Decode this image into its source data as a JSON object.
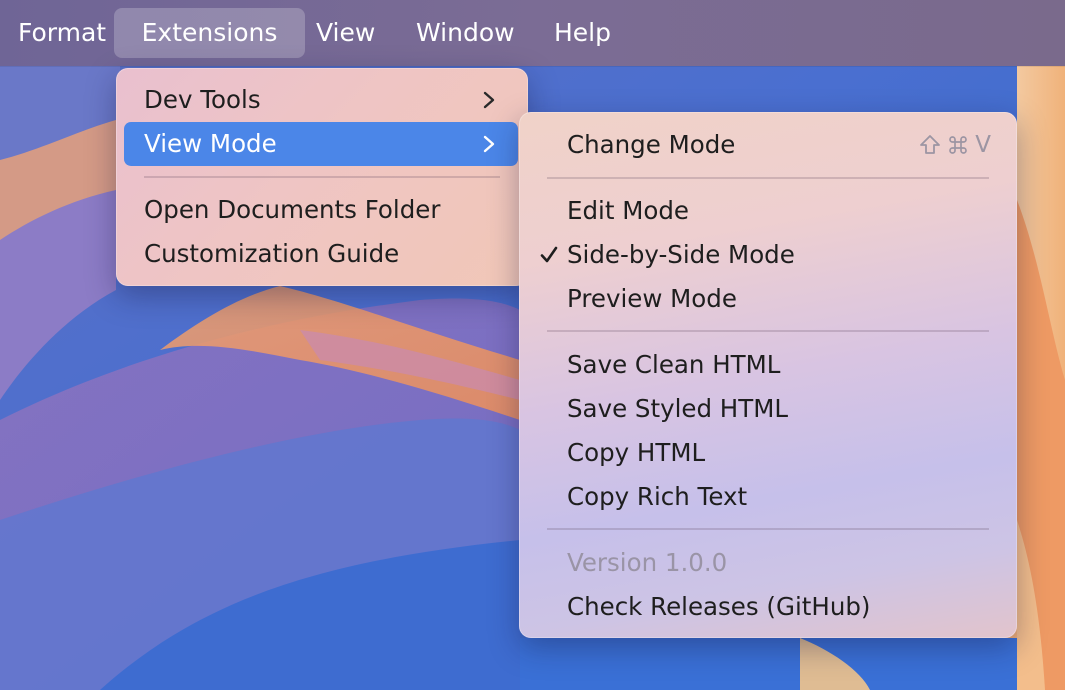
{
  "menubar": {
    "items": [
      {
        "label": "Format"
      },
      {
        "label": "Extensions"
      },
      {
        "label": "View"
      },
      {
        "label": "Window"
      },
      {
        "label": "Help"
      }
    ],
    "active_item": "Extensions"
  },
  "extensions_menu": {
    "items": [
      {
        "label": "Dev Tools",
        "submenu": true
      },
      {
        "label": "View Mode",
        "submenu": true,
        "highlighted": true
      },
      {
        "label": "Open Documents Folder"
      },
      {
        "label": "Customization Guide"
      }
    ]
  },
  "view_mode_submenu": {
    "change_mode": {
      "label": "Change Mode",
      "shortcut": "V"
    },
    "modes": [
      {
        "label": "Edit Mode",
        "checked": false
      },
      {
        "label": "Side-by-Side Mode",
        "checked": true
      },
      {
        "label": "Preview Mode",
        "checked": false
      }
    ],
    "export": [
      {
        "label": "Save Clean HTML"
      },
      {
        "label": "Save Styled HTML"
      },
      {
        "label": "Copy HTML"
      },
      {
        "label": "Copy Rich Text"
      }
    ],
    "version": {
      "label": "Version 1.0.0",
      "disabled": true
    },
    "releases": {
      "label": "Check Releases (GitHub)"
    }
  },
  "icons": {
    "submenu_arrow": "chevron-right-icon",
    "check": "checkmark-icon",
    "shift": "shift-key-icon",
    "command": "command-key-icon"
  },
  "colors": {
    "highlight": "#4b86e8",
    "menubar": "#75698f",
    "disabled_text": "#9a94a6"
  }
}
